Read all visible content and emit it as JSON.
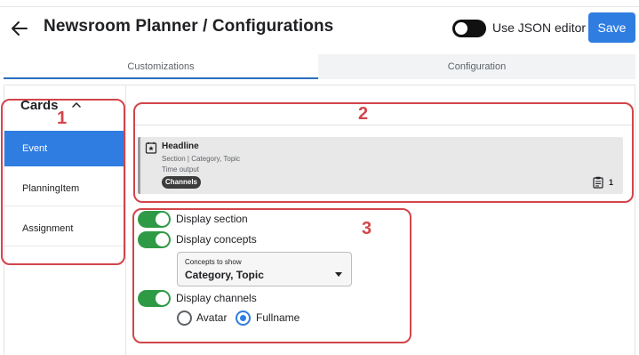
{
  "header": {
    "title": "Newsroom Planner / Configurations",
    "json_editor_label": "Use JSON editor",
    "json_editor_on": false,
    "save_label": "Save"
  },
  "tabs": [
    {
      "label": "Customizations",
      "active": true
    },
    {
      "label": "Configuration",
      "active": false
    }
  ],
  "sidebar": {
    "title": "Cards",
    "items": [
      {
        "label": "Event",
        "active": true
      },
      {
        "label": "PlanningItem",
        "active": false
      },
      {
        "label": "Assignment",
        "active": false
      }
    ]
  },
  "preview": {
    "headline": "Headline",
    "line1": "Section | Category, Topic",
    "line2": "Time output",
    "chip": "Channels",
    "count": "1"
  },
  "options": {
    "display_section": "Display section",
    "display_concepts": "Display concepts",
    "concepts_select_label": "Concepts to show",
    "concepts_select_value": "Category, Topic",
    "display_channels": "Display channels",
    "channel_options": [
      {
        "label": "Avatar",
        "selected": false
      },
      {
        "label": "Fullname",
        "selected": true
      }
    ]
  },
  "annotations": [
    "1",
    "2",
    "3"
  ],
  "colors": {
    "accent": "#2f7de1",
    "toggle_on": "#2f9a45",
    "annotation": "#d2454b"
  }
}
